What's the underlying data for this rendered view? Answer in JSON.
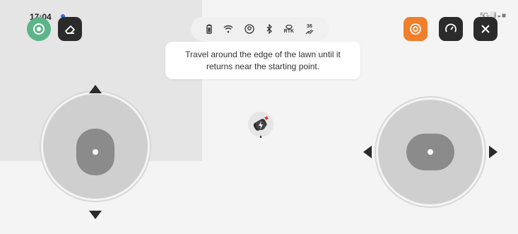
{
  "status_bar": {
    "time": "17:04",
    "signal_text": "5G·░il ◒ ■"
  },
  "top_left": {
    "mode_button_icon": "target-icon",
    "erase_button_icon": "eraser-icon"
  },
  "top_right": {
    "record_button_color": "#f07e2b",
    "speed_button_icon": "speedometer-icon",
    "close_button_icon": "close-icon"
  },
  "status_icons": {
    "gps_label": "RTK",
    "satellite_count": "36"
  },
  "tooltip": {
    "text": "Travel around the edge of the lawn until it returns near the starting point."
  },
  "colors": {
    "accent_green": "#5cb488",
    "accent_orange": "#f07e2b",
    "dark_button": "#2b2b2b",
    "joystick_outer": "#cfcfcf",
    "joystick_knob": "#8b8b8b"
  }
}
